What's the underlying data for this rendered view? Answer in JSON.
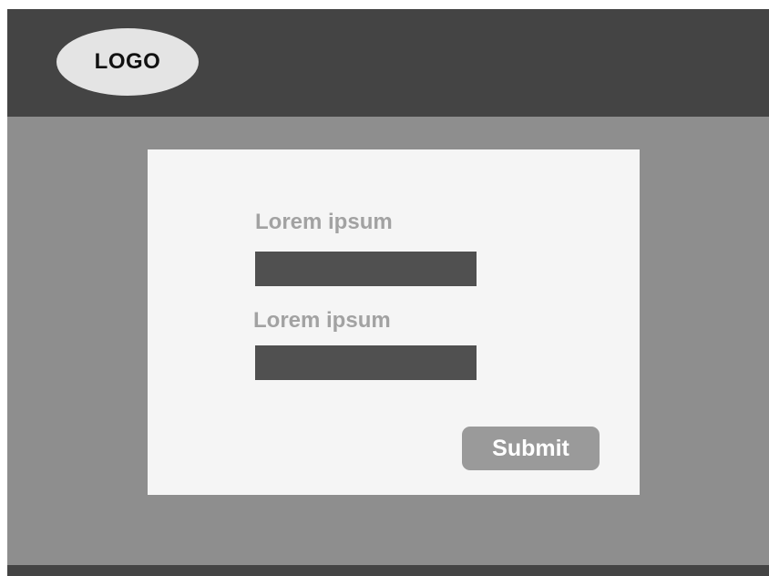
{
  "header": {
    "logo_text": "LOGO"
  },
  "form": {
    "fields": [
      {
        "label": "Lorem ipsum",
        "value": ""
      },
      {
        "label": "Lorem ipsum",
        "value": ""
      }
    ],
    "submit_label": "Submit"
  },
  "colors": {
    "header_bg": "#444444",
    "page_bg": "#8e8e8e",
    "card_bg": "#f5f5f5",
    "input_bg": "#505050",
    "button_bg": "#9a9a9a",
    "label_text": "#a2a2a2"
  }
}
